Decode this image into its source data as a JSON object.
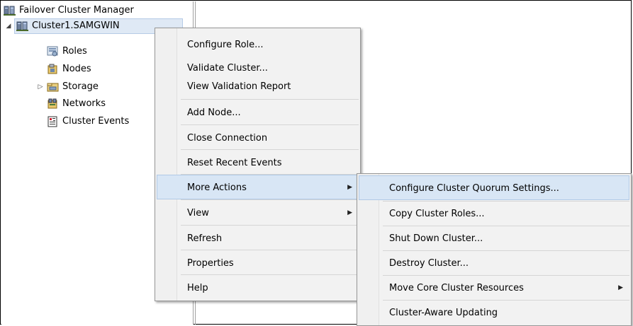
{
  "tree": {
    "root": {
      "label": "Failover Cluster Manager",
      "icon": "failover-cluster-manager-icon"
    },
    "cluster": {
      "label": "Cluster1.SAMGWIN",
      "icon": "cluster-icon",
      "expander": "◢"
    },
    "children": [
      {
        "label": "Roles",
        "icon": "roles-icon"
      },
      {
        "label": "Nodes",
        "icon": "nodes-icon"
      },
      {
        "label": "Storage",
        "icon": "storage-icon",
        "expander": "▷"
      },
      {
        "label": "Networks",
        "icon": "networks-icon"
      },
      {
        "label": "Cluster Events",
        "icon": "cluster-events-icon"
      }
    ]
  },
  "context_menu": {
    "items": [
      {
        "label": "Configure Role..."
      },
      {
        "label": "Validate Cluster..."
      },
      {
        "label": "View Validation Report"
      },
      {
        "label": "Add Node..."
      },
      {
        "label": "Close Connection"
      },
      {
        "label": "Reset Recent Events"
      },
      {
        "label": "More Actions",
        "submenu_arrow": "▶"
      },
      {
        "label": "View",
        "submenu_arrow": "▶"
      },
      {
        "label": "Refresh"
      },
      {
        "label": "Properties"
      },
      {
        "label": "Help"
      }
    ],
    "highlighted": "More Actions"
  },
  "submenu": {
    "items": [
      {
        "label": "Configure Cluster Quorum Settings..."
      },
      {
        "label": "Copy Cluster Roles..."
      },
      {
        "label": "Shut Down Cluster..."
      },
      {
        "label": "Destroy Cluster..."
      },
      {
        "label": "Move Core Cluster Resources",
        "submenu_arrow": "▶"
      },
      {
        "label": "Cluster-Aware Updating"
      }
    ],
    "highlighted": "Configure Cluster Quorum Settings..."
  },
  "colors": {
    "menu_bg": "#f2f2f2",
    "highlight_bg": "#d8e6f5",
    "highlight_border": "#b0c9e6",
    "selected_tree_bg": "#dfe9f5"
  }
}
